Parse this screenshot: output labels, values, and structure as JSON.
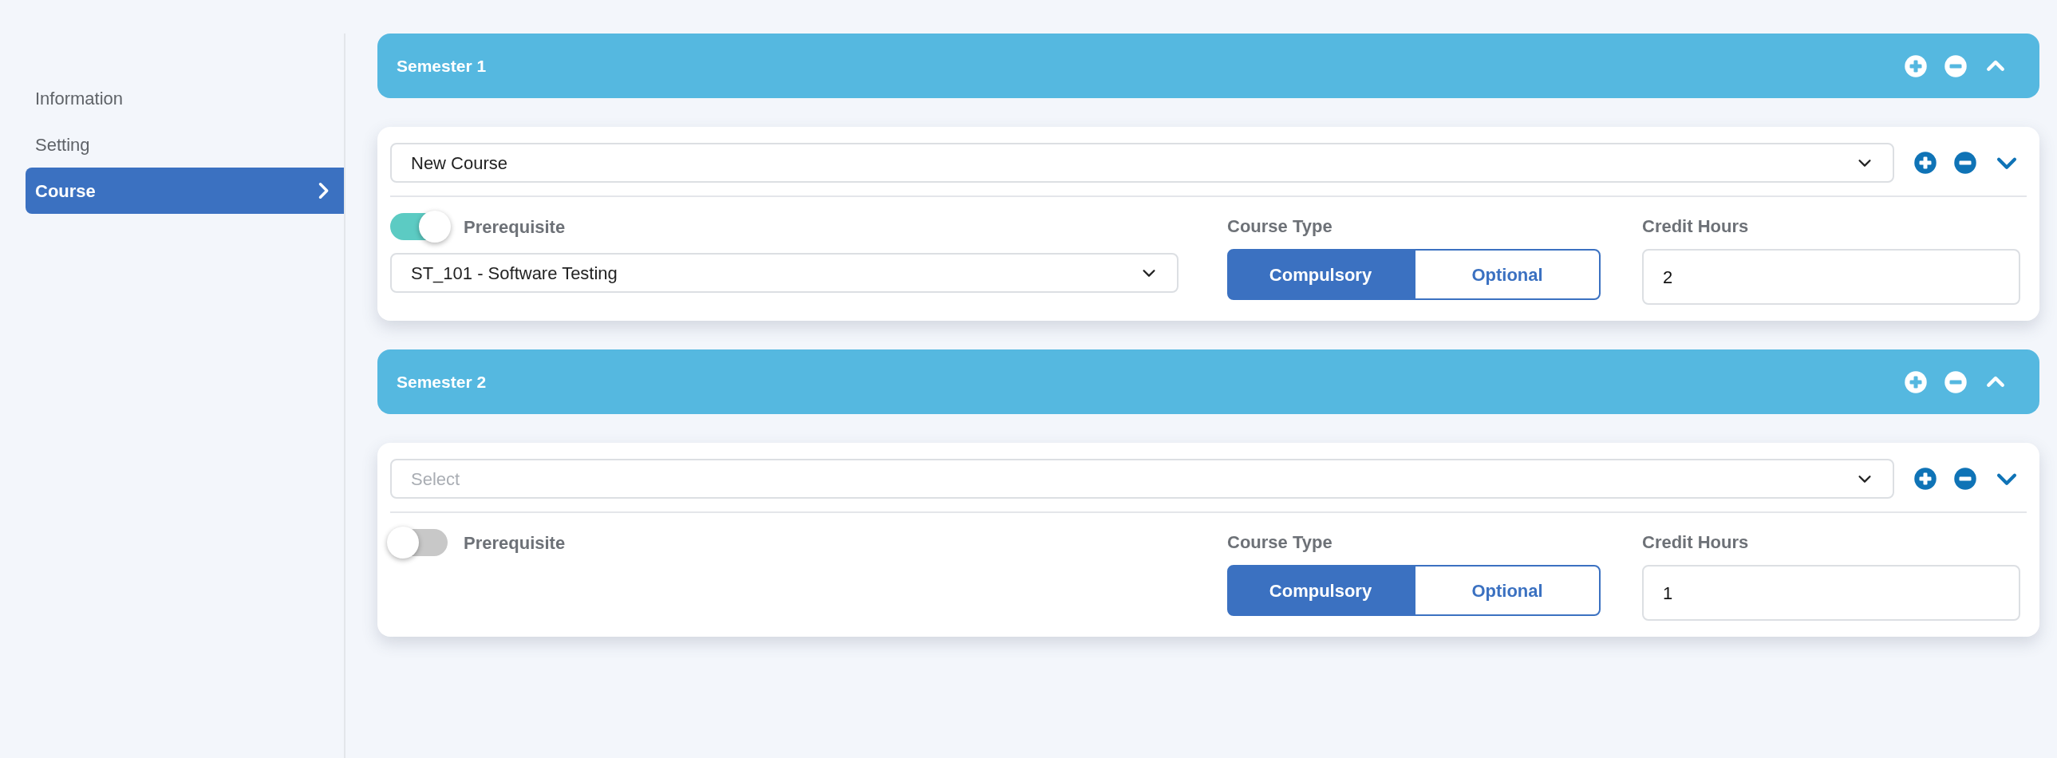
{
  "sidebar": {
    "items": [
      {
        "label": "Information",
        "selected": false
      },
      {
        "label": "Setting",
        "selected": false
      },
      {
        "label": "Course",
        "selected": true
      }
    ]
  },
  "semesters": [
    {
      "title": "Semester 1",
      "expanded": true,
      "courses": [
        {
          "course_select": {
            "value": "New Course"
          },
          "prerequisite": {
            "on": true,
            "label": "Prerequisite",
            "value": "ST_101 - Software Testing"
          },
          "course_type_label": "Course Type",
          "course_types": [
            {
              "label": "Compulsory",
              "selected": true
            },
            {
              "label": "Optional",
              "selected": false
            }
          ],
          "credit_hours_label": "Credit Hours",
          "credit_hours": "2"
        }
      ]
    },
    {
      "title": "Semester 2",
      "expanded": true,
      "courses": [
        {
          "course_select": {
            "placeholder": "Select"
          },
          "prerequisite": {
            "on": false,
            "label": "Prerequisite"
          },
          "course_type_label": "Course Type",
          "course_types": [
            {
              "label": "Compulsory",
              "selected": true
            },
            {
              "label": "Optional",
              "selected": false
            }
          ],
          "credit_hours_label": "Credit Hours",
          "credit_hours": "1"
        }
      ]
    }
  ]
}
